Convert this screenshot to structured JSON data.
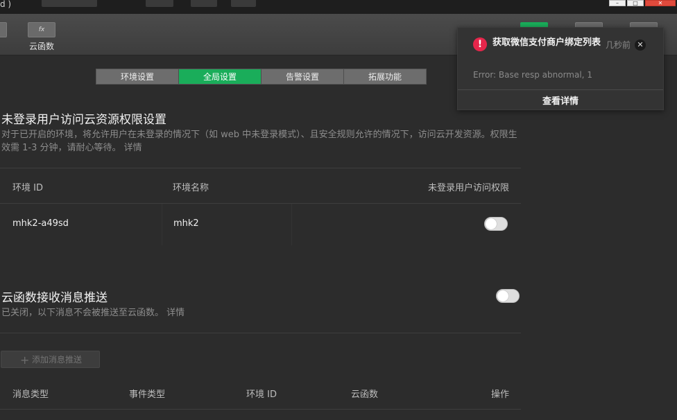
{
  "window": {
    "title": "d )"
  },
  "toolbar": {
    "cloud_function_label": "云函数",
    "cloud_function_icon": "fx"
  },
  "tabs": [
    {
      "label": "环境设置",
      "active": false
    },
    {
      "label": "全局设置",
      "active": true
    },
    {
      "label": "告警设置",
      "active": false
    },
    {
      "label": "拓展功能",
      "active": false
    }
  ],
  "unauth_section": {
    "title": "未登录用户访问云资源权限设置",
    "desc_line1": "对于已开启的环境，将允许用户在未登录的情况下（如 web 中未登录模式）、且安全规则允许的情况下，访问云开发资源。权限生",
    "desc_line2": "效需 1-3 分钟，请耐心等待。",
    "detail_link": "详情",
    "columns": [
      "环境 ID",
      "环境名称",
      "未登录用户访问权限"
    ],
    "rows": [
      {
        "env_id": "mhk2-a49sd",
        "env_name": "mhk2",
        "enabled": false
      }
    ]
  },
  "push_section": {
    "title": "云函数接收消息推送",
    "desc": "已关闭，以下消息不会被推送至云函数。",
    "detail_link": "详情",
    "enabled": false,
    "add_button": "添加消息推送",
    "columns": [
      "消息类型",
      "事件类型",
      "环境 ID",
      "云函数",
      "操作"
    ]
  },
  "notification": {
    "title": "获取微信支付商户绑定列表",
    "time": "几秒前",
    "message": "Error: Base resp abnormal, 1",
    "action": "查看详情"
  },
  "colors": {
    "accent": "#1aad5a",
    "error": "#e5264b",
    "background": "#2c2c2c"
  }
}
